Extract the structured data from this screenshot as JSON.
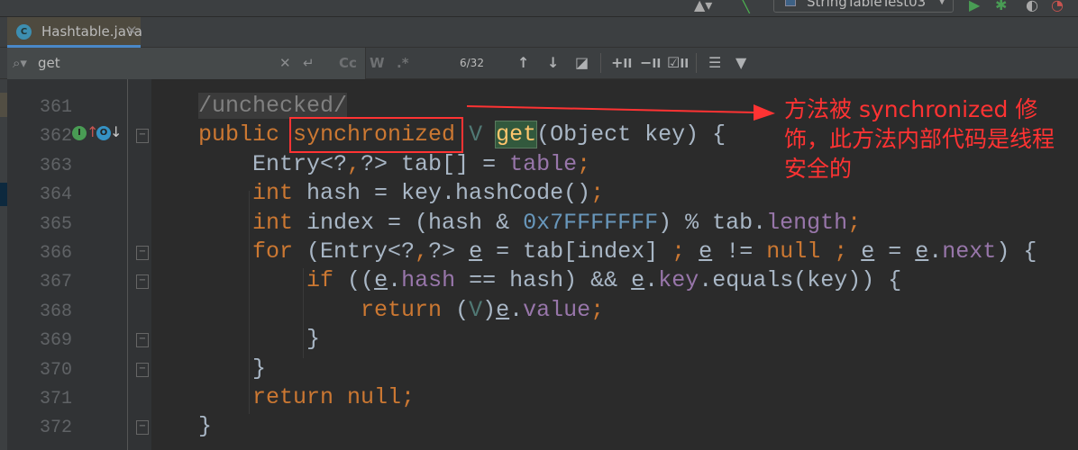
{
  "toolbar": {
    "run_config": "StringTableTest03"
  },
  "tabs": [
    {
      "label": "Hashtable.java",
      "icon": "class-locked-icon"
    }
  ],
  "search": {
    "value": "get",
    "match_case": "Cc",
    "words": "W",
    "regex": ".*",
    "count": "6/32"
  },
  "gutter": {
    "lines": [
      "361",
      "362",
      "363",
      "364",
      "365",
      "366",
      "367",
      "368",
      "369",
      "370",
      "371",
      "372"
    ]
  },
  "code": [
    [
      {
        "t": "/unchecked/",
        "c": "cm"
      }
    ],
    [
      {
        "t": "public ",
        "c": "kw"
      },
      {
        "t": "synchronized",
        "c": "kw"
      },
      {
        "t": " ",
        "c": ""
      },
      {
        "t": "V",
        "c": "tp"
      },
      {
        "t": " ",
        "c": ""
      },
      {
        "t": "get",
        "c": "hl"
      },
      {
        "t": "(Object key) {",
        "c": ""
      }
    ],
    [
      {
        "t": "    Entry<?",
        "c": ""
      },
      {
        "t": ",",
        "c": "kw"
      },
      {
        "t": "?> tab[] = ",
        "c": ""
      },
      {
        "t": "table",
        "c": "fld"
      },
      {
        "t": ";",
        "c": "kw"
      }
    ],
    [
      {
        "t": "    ",
        "c": ""
      },
      {
        "t": "int ",
        "c": "kw"
      },
      {
        "t": "hash = key.hashCode()",
        "c": ""
      },
      {
        "t": ";",
        "c": "kw"
      }
    ],
    [
      {
        "t": "    ",
        "c": ""
      },
      {
        "t": "int ",
        "c": "kw"
      },
      {
        "t": "index = (hash & ",
        "c": ""
      },
      {
        "t": "0x7FFFFFFF",
        "c": "num"
      },
      {
        "t": ") % tab.",
        "c": ""
      },
      {
        "t": "length",
        "c": "fld"
      },
      {
        "t": ";",
        "c": "kw"
      }
    ],
    [
      {
        "t": "    ",
        "c": ""
      },
      {
        "t": "for ",
        "c": "kw"
      },
      {
        "t": "(Entry<?",
        "c": ""
      },
      {
        "t": ",",
        "c": "kw"
      },
      {
        "t": "?> ",
        "c": ""
      },
      {
        "t": "e",
        "c": "ul"
      },
      {
        "t": " = tab[index] ",
        "c": ""
      },
      {
        "t": "; ",
        "c": "kw"
      },
      {
        "t": "e",
        "c": "ul"
      },
      {
        "t": " != ",
        "c": ""
      },
      {
        "t": "null ",
        "c": "kw"
      },
      {
        "t": "; ",
        "c": "kw"
      },
      {
        "t": "e",
        "c": "ul"
      },
      {
        "t": " = ",
        "c": ""
      },
      {
        "t": "e",
        "c": "ul"
      },
      {
        "t": ".",
        "c": ""
      },
      {
        "t": "next",
        "c": "fld"
      },
      {
        "t": ") {",
        "c": ""
      }
    ],
    [
      {
        "t": "        ",
        "c": ""
      },
      {
        "t": "if ",
        "c": "kw"
      },
      {
        "t": "((",
        "c": ""
      },
      {
        "t": "e",
        "c": "ul"
      },
      {
        "t": ".",
        "c": ""
      },
      {
        "t": "hash",
        "c": "fld"
      },
      {
        "t": " == hash) && ",
        "c": ""
      },
      {
        "t": "e",
        "c": "ul"
      },
      {
        "t": ".",
        "c": ""
      },
      {
        "t": "key",
        "c": "fld"
      },
      {
        "t": ".equals(key)) {",
        "c": ""
      }
    ],
    [
      {
        "t": "            ",
        "c": ""
      },
      {
        "t": "return ",
        "c": "kw"
      },
      {
        "t": "(",
        "c": ""
      },
      {
        "t": "V",
        "c": "tp"
      },
      {
        "t": ")",
        "c": ""
      },
      {
        "t": "e",
        "c": "ul"
      },
      {
        "t": ".",
        "c": ""
      },
      {
        "t": "value",
        "c": "fld"
      },
      {
        "t": ";",
        "c": "kw"
      }
    ],
    [
      {
        "t": "        }",
        "c": ""
      }
    ],
    [
      {
        "t": "    }",
        "c": ""
      }
    ],
    [
      {
        "t": "    ",
        "c": ""
      },
      {
        "t": "return null",
        "c": "kw"
      },
      {
        "t": ";",
        "c": "kw"
      }
    ],
    [
      {
        "t": "}",
        "c": ""
      }
    ]
  ],
  "annotation": {
    "text": "方法被 synchronized 修饰，此方法内部代码是线程安全的",
    "color": "#ff3333"
  },
  "colors": {
    "background": "#2b2b2b",
    "keyword": "#cc7832",
    "identifier": "#a9b7c6",
    "field": "#9876aa",
    "number": "#6897bb"
  }
}
